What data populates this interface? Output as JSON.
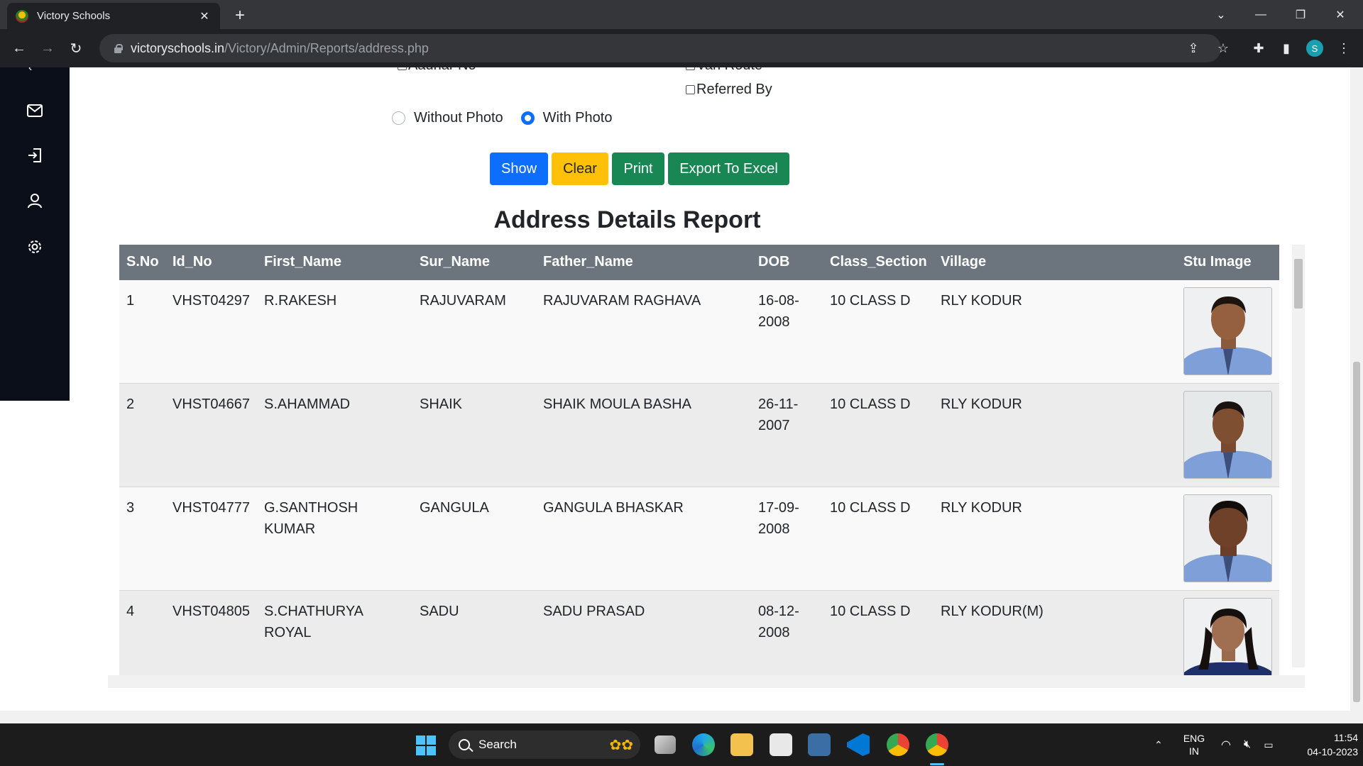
{
  "browser": {
    "tab_title": "Victory Schools",
    "url_host": "victoryschools.in",
    "url_path": "/Victory/Admin/Reports/address.php"
  },
  "filters": {
    "checkboxes": [
      {
        "label": "Aadhar No",
        "checked": false
      },
      {
        "label": "Van Route",
        "checked": false
      },
      {
        "label": "Referred By",
        "checked": false
      }
    ],
    "photo_options": [
      {
        "label": "Without Photo",
        "selected": false
      },
      {
        "label": "With Photo",
        "selected": true
      }
    ]
  },
  "buttons": {
    "show": "Show",
    "clear": "Clear",
    "print": "Print",
    "export": "Export To Excel"
  },
  "report": {
    "title": "Address Details Report",
    "columns": [
      "S.No",
      "Id_No",
      "First_Name",
      "Sur_Name",
      "Father_Name",
      "DOB",
      "Class_Section",
      "Village",
      "Stu Image"
    ],
    "rows": [
      {
        "sno": "1",
        "id": "VHST04297",
        "first": "R.RAKESH",
        "sur": "RAJUVARAM",
        "father": "RAJUVARAM RAGHAVA",
        "dob": "16-08-2008",
        "class": "10 CLASS D",
        "village": "RLY KODUR"
      },
      {
        "sno": "2",
        "id": "VHST04667",
        "first": "S.AHAMMAD",
        "sur": "SHAIK",
        "father": "SHAIK MOULA BASHA",
        "dob": "26-11-2007",
        "class": "10 CLASS D",
        "village": "RLY KODUR"
      },
      {
        "sno": "3",
        "id": "VHST04777",
        "first": "G.SANTHOSH KUMAR",
        "sur": "GANGULA",
        "father": "GANGULA BHASKAR",
        "dob": "17-09-2008",
        "class": "10 CLASS D",
        "village": "RLY KODUR"
      },
      {
        "sno": "4",
        "id": "VHST04805",
        "first": "S.CHATHURYA ROYAL",
        "sur": "SADU",
        "father": "SADU PRASAD",
        "dob": "08-12-2008",
        "class": "10 CLASS D",
        "village": "RLY KODUR(M)"
      }
    ]
  },
  "taskbar": {
    "search_label": "Search",
    "lang_line1": "ENG",
    "lang_line2": "IN",
    "time": "11:54",
    "date": "04-10-2023"
  },
  "colors": {
    "primary": "#0d6efd",
    "warning": "#ffc107",
    "success": "#198754",
    "table_header": "#6c757d",
    "sidebar": "#0b0f19"
  }
}
